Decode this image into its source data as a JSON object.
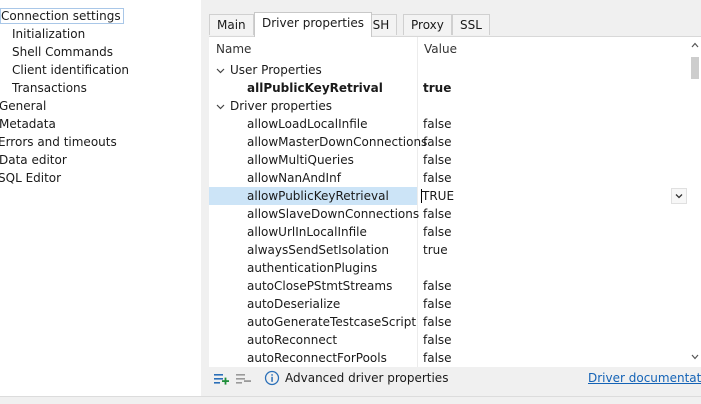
{
  "nav": {
    "items": [
      {
        "label": "Connection settings",
        "level": 0,
        "selected": true
      },
      {
        "label": "Initialization",
        "level": 1
      },
      {
        "label": "Shell Commands",
        "level": 1
      },
      {
        "label": "Client identification",
        "level": 1
      },
      {
        "label": "Transactions",
        "level": 1
      },
      {
        "label": "General",
        "level": 0
      },
      {
        "label": "Metadata",
        "level": 0
      },
      {
        "label": "Errors and timeouts",
        "level": 0
      },
      {
        "label": "Data editor",
        "level": 0
      },
      {
        "label": "SQL Editor",
        "level": 0
      }
    ]
  },
  "tabs": {
    "main": "Main",
    "driver": "Driver properties",
    "ssh": "SSH",
    "proxy": "Proxy",
    "ssl": "SSL"
  },
  "table": {
    "col_name": "Name",
    "col_value": "Value",
    "rows": [
      {
        "name": "User Properties",
        "value": "",
        "type": "group"
      },
      {
        "name": "allPublicKeyRetrival",
        "value": "true",
        "type": "bold"
      },
      {
        "name": "Driver properties",
        "value": "",
        "type": "group"
      },
      {
        "name": "allowLoadLocalInfile",
        "value": "false"
      },
      {
        "name": "allowMasterDownConnections",
        "value": "false"
      },
      {
        "name": "allowMultiQueries",
        "value": "false"
      },
      {
        "name": "allowNanAndInf",
        "value": "false"
      },
      {
        "name": "allowPublicKeyRetrieval",
        "value": "TRUE",
        "type": "selected"
      },
      {
        "name": "allowSlaveDownConnections",
        "value": "false"
      },
      {
        "name": "allowUrlInLocalInfile",
        "value": "false"
      },
      {
        "name": "alwaysSendSetIsolation",
        "value": "true"
      },
      {
        "name": "authenticationPlugins",
        "value": ""
      },
      {
        "name": "autoClosePStmtStreams",
        "value": "false"
      },
      {
        "name": "autoDeserialize",
        "value": "false"
      },
      {
        "name": "autoGenerateTestcaseScript",
        "value": "false"
      },
      {
        "name": "autoReconnect",
        "value": "false"
      },
      {
        "name": "autoReconnectForPools",
        "value": "false"
      }
    ]
  },
  "footer": {
    "advanced_label": "Advanced driver properties",
    "doc_link": "Driver documentation"
  },
  "colors": {
    "selected_row": "#cce4f7",
    "link": "#1463b6",
    "icon_green": "#1f8f3a",
    "icon_blue": "#2a6fb8"
  }
}
